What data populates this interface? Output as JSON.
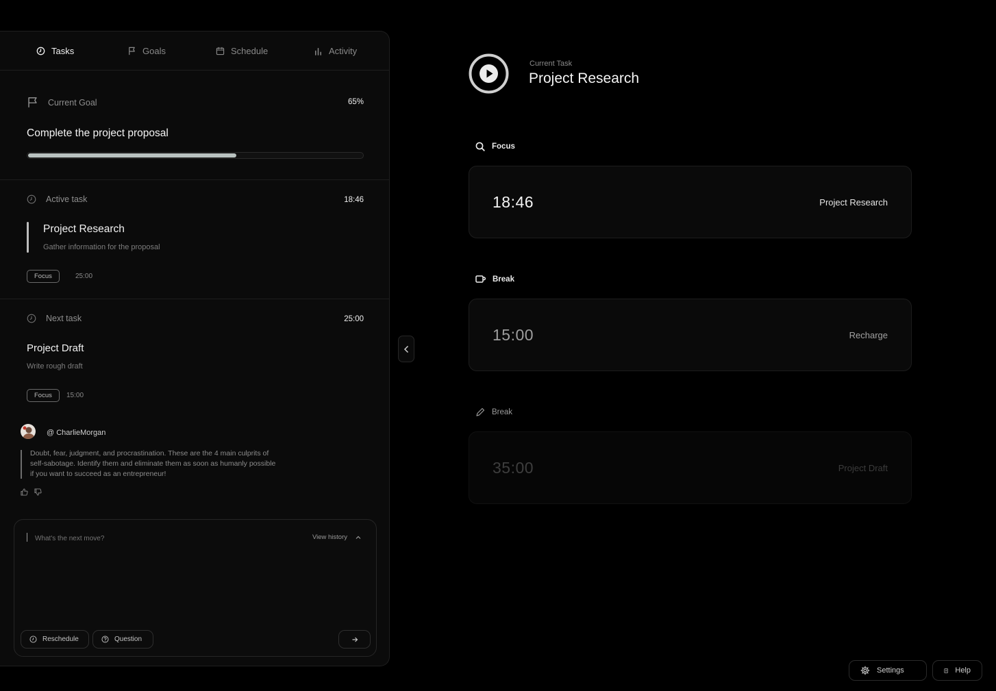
{
  "tabs": [
    {
      "label": "Tasks",
      "icon": "clock-icon",
      "active": true
    },
    {
      "label": "Goals",
      "icon": "flag-icon",
      "active": false
    },
    {
      "label": "Schedule",
      "icon": "calendar-icon",
      "active": false
    },
    {
      "label": "Activity",
      "icon": "bar-chart-icon",
      "active": false
    }
  ],
  "goal": {
    "label": "Current Goal",
    "percent_text": "65%",
    "progress": 0.62,
    "title": "Complete the project proposal"
  },
  "active_task": {
    "label": "Active task",
    "time": "18:46",
    "title": "Project Research",
    "subtitle": "Gather information for the proposal",
    "chip": "Focus",
    "duration": "25:00"
  },
  "next_task": {
    "label": "Next task",
    "time": "25:00",
    "title": "Project Draft",
    "subtitle": "Write rough draft",
    "chip": "Focus",
    "duration": "15:00"
  },
  "comment": {
    "user": "@ CharlieMorgan",
    "text": "Doubt, fear, judgment, and procrastination.  These are the 4 main culprits of self-sabotage.  Identify them and eliminate them as soon as humanly possible if you want to succeed as an entrepreneur!"
  },
  "composer": {
    "placeholder": "What's the next move?",
    "history_label": "View history",
    "reschedule_label": "Reschedule",
    "question_label": "Question"
  },
  "current": {
    "label": "Current Task",
    "title": "Project Research"
  },
  "sessions": [
    {
      "section": "Focus",
      "icon": "search-icon",
      "time": "18:46",
      "label": "Project Research"
    },
    {
      "section": "Break",
      "icon": "cup-icon",
      "time": "15:00",
      "label": "Recharge"
    },
    {
      "section": "Break",
      "icon": "pencil-icon",
      "time": "35:00",
      "label": "Project Draft"
    }
  ],
  "footer": {
    "settings_label": "Settings",
    "help_label": "Help"
  },
  "colors": {
    "background": "#000000",
    "panel": "#0b0b0b",
    "progress_fill": "#b9c2c0"
  }
}
